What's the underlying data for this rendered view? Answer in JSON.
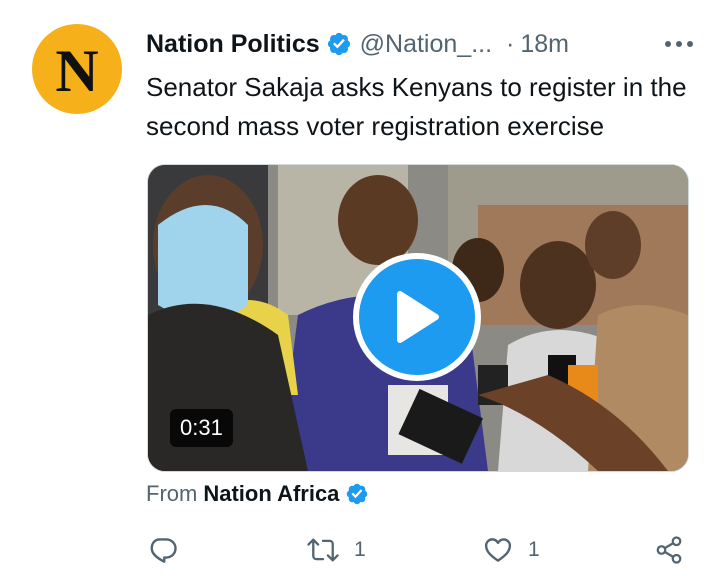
{
  "tweet": {
    "avatar_letter": "N",
    "author_name": "Nation Politics",
    "handle": "@Nation_...",
    "separator": "·",
    "time": "18m",
    "text": "Senator Sakaja asks Kenyans to register in the second mass voter registration exercise",
    "verified": true
  },
  "media": {
    "type": "video",
    "duration": "0:31"
  },
  "source": {
    "prefix": "From",
    "name": "Nation Africa"
  },
  "actions": {
    "reply": {
      "icon": "reply-icon"
    },
    "retweet": {
      "icon": "retweet-icon",
      "count": "1"
    },
    "like": {
      "icon": "heart-icon",
      "count": "1"
    },
    "share": {
      "icon": "share-icon"
    }
  },
  "colors": {
    "accent": "#1d9bf0",
    "avatar_bg": "#f5b01a",
    "secondary_text": "#536471"
  }
}
